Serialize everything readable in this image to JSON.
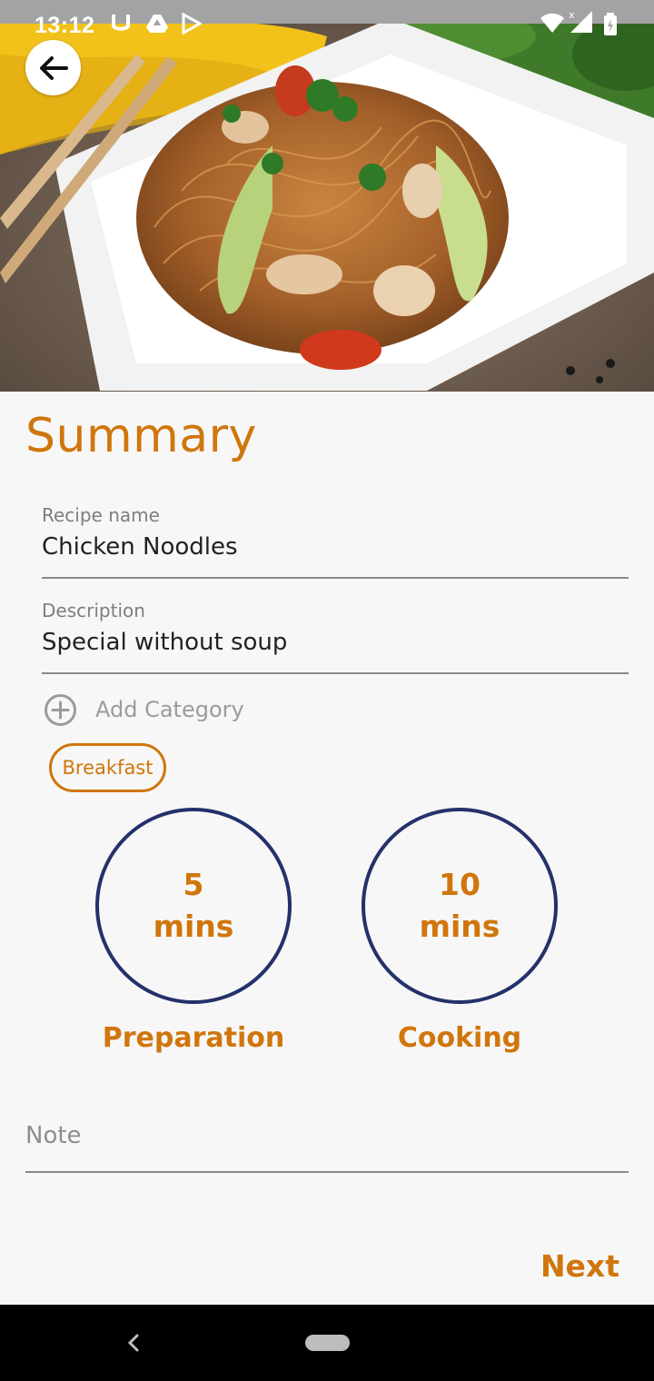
{
  "status_bar": {
    "time": "13:12"
  },
  "header": {
    "back_icon": "arrow-left-icon"
  },
  "summary": {
    "title": "Summary"
  },
  "recipe_name": {
    "label": "Recipe name",
    "value": "Chicken Noodles"
  },
  "description": {
    "label": "Description",
    "value": "Special without soup"
  },
  "category": {
    "add_label": "Add Category",
    "add_icon": "add-circle-icon",
    "selected": [
      "Breakfast"
    ]
  },
  "times": [
    {
      "value": "5",
      "unit": "mins",
      "label": "Preparation"
    },
    {
      "value": "10",
      "unit": "mins",
      "label": "Cooking"
    }
  ],
  "note": {
    "placeholder": "Note"
  },
  "actions": {
    "next_label": "Next"
  },
  "colors": {
    "accent": "#d0760c",
    "ring": "#24316a",
    "background": "#f7f7f7"
  }
}
